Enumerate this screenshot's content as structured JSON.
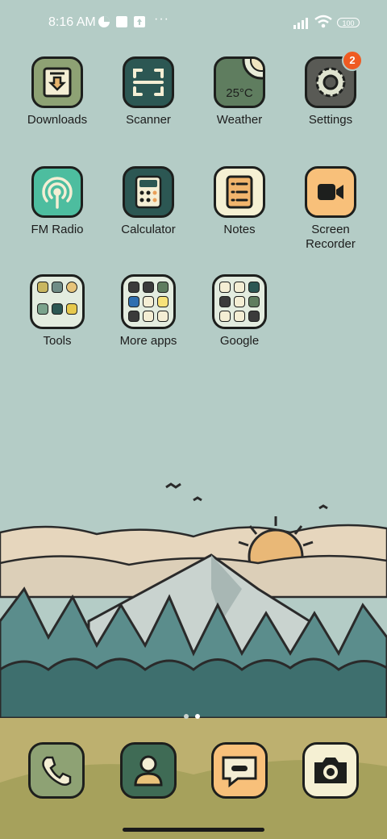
{
  "status": {
    "time": "8:16 AM",
    "battery": "100"
  },
  "apps": [
    {
      "label": "Downloads"
    },
    {
      "label": "Scanner"
    },
    {
      "label": "Weather",
      "temp": "25°C"
    },
    {
      "label": "Settings",
      "badge": "2"
    },
    {
      "label": "FM Radio"
    },
    {
      "label": "Calculator"
    },
    {
      "label": "Notes"
    },
    {
      "label": "Screen\nRecorder"
    }
  ],
  "folders": [
    {
      "label": "Tools"
    },
    {
      "label": "More apps"
    },
    {
      "label": "Google"
    }
  ],
  "dock": [
    {
      "icon": "phone-icon"
    },
    {
      "icon": "contacts-icon"
    },
    {
      "icon": "messages-icon"
    },
    {
      "icon": "camera-icon"
    }
  ],
  "page_indicator": {
    "pages": 2,
    "current": 2
  },
  "colors": {
    "wallpaper_sky": "#b4ccc6",
    "badge": "#ef5b22"
  }
}
